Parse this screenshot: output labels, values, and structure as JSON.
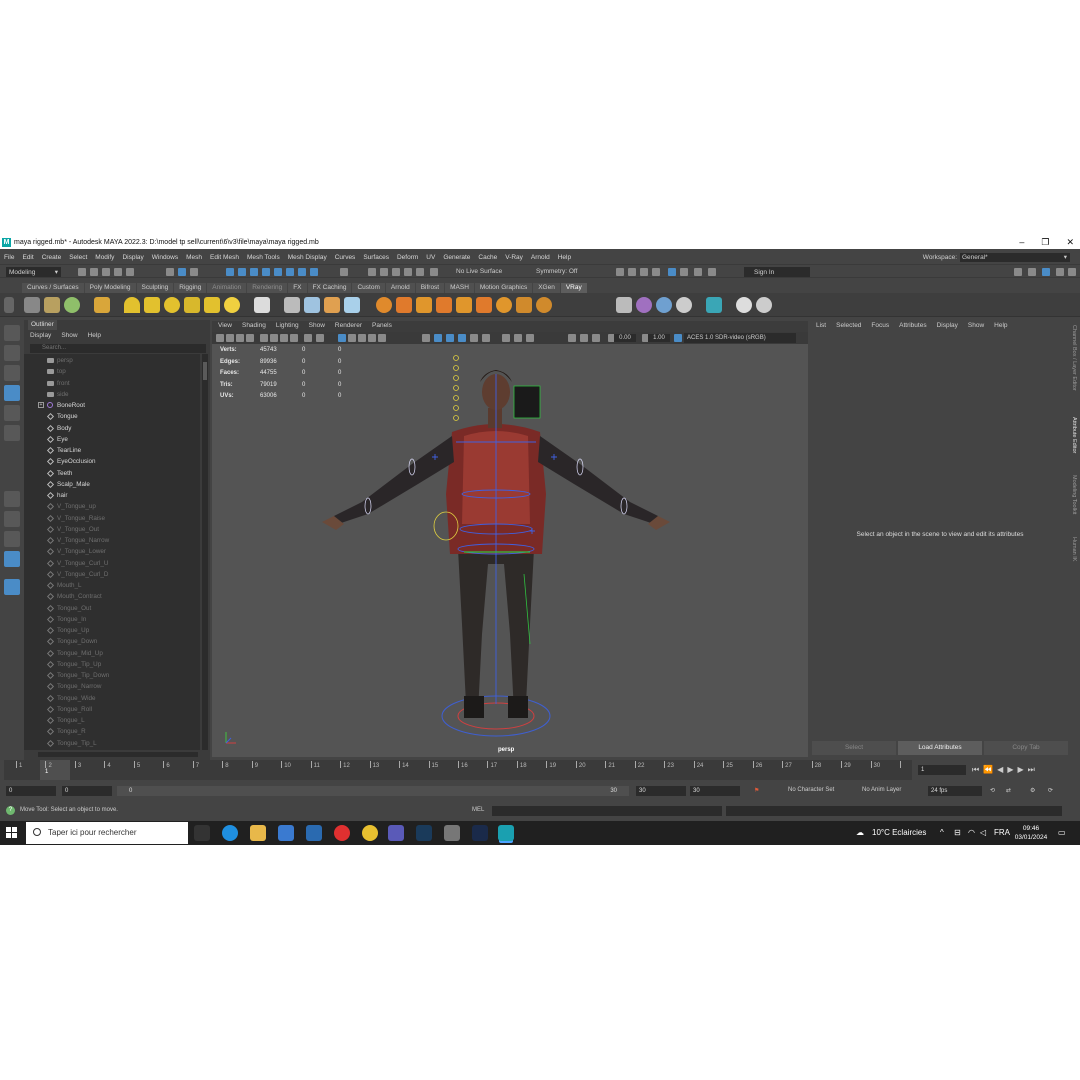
{
  "window": {
    "title": "maya rigged.mb* - Autodesk MAYA 2022.3: D:\\model tp sell\\current\\6\\v3\\file\\maya\\maya rigged.mb",
    "logo": "M"
  },
  "menubar": {
    "items": [
      "File",
      "Edit",
      "Create",
      "Select",
      "Modify",
      "Display",
      "Windows",
      "Mesh",
      "Edit Mesh",
      "Mesh Tools",
      "Mesh Display",
      "Curves",
      "Surfaces",
      "Deform",
      "UV",
      "Generate",
      "Cache",
      "V-Ray",
      "Arnold",
      "Help"
    ],
    "workspace_label": "Workspace:",
    "workspace_value": "General*"
  },
  "statusline": {
    "mode": "Modeling",
    "live_surface": "No Live Surface",
    "symmetry": "Symmetry: Off",
    "sign_in": "Sign In"
  },
  "shelf": {
    "tabs": [
      "Curves / Surfaces",
      "Poly Modeling",
      "Sculpting",
      "Rigging",
      "Animation",
      "Rendering",
      "FX",
      "FX Caching",
      "Custom",
      "Arnold",
      "Bifrost",
      "MASH",
      "Motion Graphics",
      "XGen",
      "VRay"
    ],
    "active_tab": "VRay"
  },
  "outliner": {
    "tab": "Outliner",
    "menu": [
      "Display",
      "Show",
      "Help"
    ],
    "search_placeholder": "Search...",
    "items": [
      {
        "label": "persp",
        "type": "cam"
      },
      {
        "label": "top",
        "type": "cam"
      },
      {
        "label": "front",
        "type": "cam"
      },
      {
        "label": "side",
        "type": "cam"
      },
      {
        "label": "BoneRoot",
        "type": "joint"
      },
      {
        "label": "Tongue",
        "type": "mesh"
      },
      {
        "label": "Body",
        "type": "mesh"
      },
      {
        "label": "Eye",
        "type": "mesh"
      },
      {
        "label": "TearLine",
        "type": "mesh"
      },
      {
        "label": "EyeOcclusion",
        "type": "mesh"
      },
      {
        "label": "Teeth",
        "type": "mesh"
      },
      {
        "label": "Scalp_Male",
        "type": "mesh"
      },
      {
        "label": "hair",
        "type": "mesh"
      },
      {
        "label": "V_Tongue_up",
        "type": "dim"
      },
      {
        "label": "V_Tongue_Raise",
        "type": "dim"
      },
      {
        "label": "V_Tongue_Out",
        "type": "dim"
      },
      {
        "label": "V_Tongue_Narrow",
        "type": "dim"
      },
      {
        "label": "V_Tongue_Lower",
        "type": "dim"
      },
      {
        "label": "V_Tongue_Curl_U",
        "type": "dim"
      },
      {
        "label": "V_Tongue_Curl_D",
        "type": "dim"
      },
      {
        "label": "Mouth_L",
        "type": "dim"
      },
      {
        "label": "Mouth_Contract",
        "type": "dim"
      },
      {
        "label": "Tongue_Out",
        "type": "dim"
      },
      {
        "label": "Tongue_In",
        "type": "dim"
      },
      {
        "label": "Tongue_Up",
        "type": "dim"
      },
      {
        "label": "Tongue_Down",
        "type": "dim"
      },
      {
        "label": "Tongue_Mid_Up",
        "type": "dim"
      },
      {
        "label": "Tongue_Tip_Up",
        "type": "dim"
      },
      {
        "label": "Tongue_Tip_Down",
        "type": "dim"
      },
      {
        "label": "Tongue_Narrow",
        "type": "dim"
      },
      {
        "label": "Tongue_Wide",
        "type": "dim"
      },
      {
        "label": "Tongue_Roll",
        "type": "dim"
      },
      {
        "label": "Tongue_L",
        "type": "dim"
      },
      {
        "label": "Tongue_R",
        "type": "dim"
      },
      {
        "label": "Tongue_Tip_L",
        "type": "dim"
      }
    ]
  },
  "viewport": {
    "menu": [
      "View",
      "Shading",
      "Lighting",
      "Show",
      "Renderer",
      "Panels"
    ],
    "exposure": "0.00",
    "gamma": "1.00",
    "color_space": "ACES 1.0 SDR-video (sRGB)",
    "camera": "persp",
    "hud": [
      {
        "label": "Verts:",
        "v1": "45743",
        "v2": "0",
        "v3": "0"
      },
      {
        "label": "Edges:",
        "v1": "89936",
        "v2": "0",
        "v3": "0"
      },
      {
        "label": "Faces:",
        "v1": "44755",
        "v2": "0",
        "v3": "0"
      },
      {
        "label": "Tris:",
        "v1": "79019",
        "v2": "0",
        "v3": "0"
      },
      {
        "label": "UVs:",
        "v1": "63006",
        "v2": "0",
        "v3": "0"
      }
    ]
  },
  "attribute_editor": {
    "menu": [
      "List",
      "Selected",
      "Focus",
      "Attributes",
      "Display",
      "Show",
      "Help"
    ],
    "message": "Select an object in the scene to view and edit its attributes",
    "buttons": [
      "Select",
      "Load Attributes",
      "Copy Tab"
    ],
    "side_tabs": [
      "Channel Box / Layer Editor",
      "Attribute Editor",
      "Modeling Toolkit",
      "Human IK"
    ]
  },
  "timeline": {
    "labels": [
      "1",
      "2",
      "3",
      "4",
      "5",
      "6",
      "7",
      "8",
      "9",
      "10",
      "11",
      "12",
      "13",
      "14",
      "15",
      "16",
      "17",
      "18",
      "19",
      "20",
      "21",
      "22",
      "23",
      "24",
      "25",
      "26",
      "27",
      "28",
      "29",
      "30"
    ],
    "current_frame": "1",
    "current_field": "1"
  },
  "range": {
    "start": "0",
    "anim_start": "0",
    "slider_start": "0",
    "slider_end": "30",
    "anim_end": "30",
    "end": "30",
    "character_set": "No Character Set",
    "anim_layer": "No Anim Layer",
    "fps": "24 fps"
  },
  "commandline": {
    "tip": "Move Tool: Select an object to move.",
    "lang": "MEL"
  },
  "taskbar": {
    "search": "Taper ici pour rechercher",
    "weather": "10°C  Eclaircies",
    "lang": "FRA",
    "time": "09:46",
    "date": "03/01/2024"
  }
}
